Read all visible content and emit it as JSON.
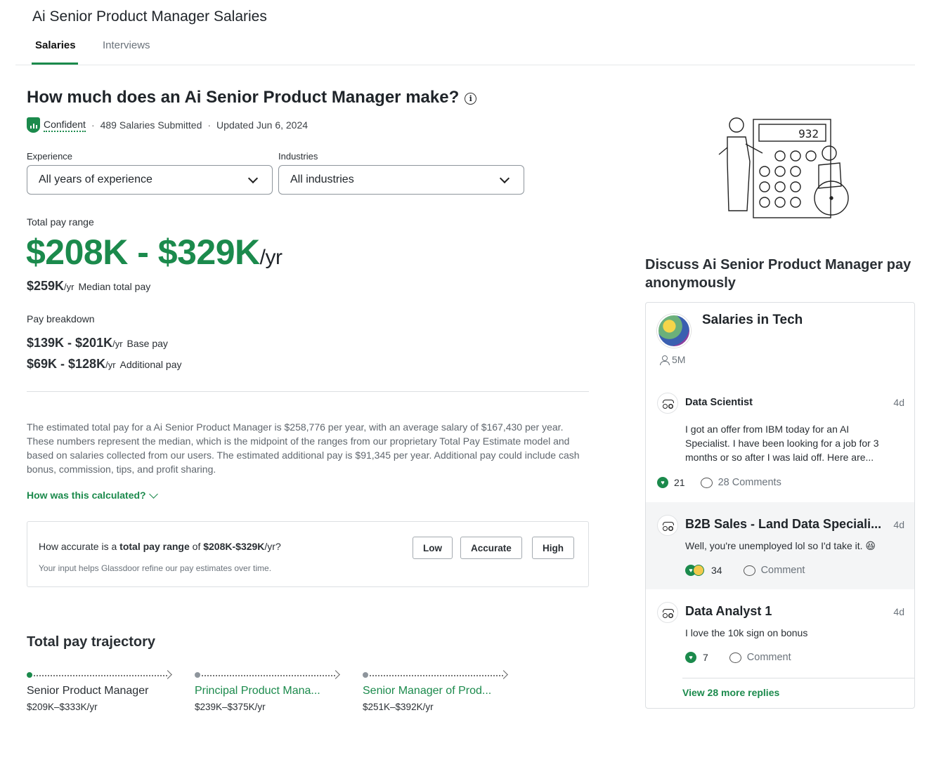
{
  "page_title": "Ai Senior Product Manager Salaries",
  "tabs": [
    {
      "label": "Salaries",
      "active": true
    },
    {
      "label": "Interviews",
      "active": false
    }
  ],
  "heading": "How much does an Ai Senior Product Manager make?",
  "meta": {
    "confidence": "Confident",
    "submitted": "489 Salaries Submitted",
    "updated": "Updated Jun 6, 2024"
  },
  "filters": {
    "experience_label": "Experience",
    "experience_value": "All years of experience",
    "industries_label": "Industries",
    "industries_value": "All industries"
  },
  "total_pay": {
    "label": "Total pay range",
    "range": "$208K - $329K",
    "unit": "/yr",
    "median_value": "$259K",
    "median_unit": "/yr",
    "median_label": "Median total pay"
  },
  "breakdown": {
    "label": "Pay breakdown",
    "base_value": "$139K - $201K",
    "base_unit": "/yr",
    "base_label": "Base pay",
    "additional_value": "$69K - $128K",
    "additional_unit": "/yr",
    "additional_label": "Additional pay"
  },
  "description": "The estimated total pay for a Ai Senior Product Manager is $258,776 per year, with an average salary of $167,430 per year. These numbers represent the median, which is the midpoint of the ranges from our proprietary Total Pay Estimate model and based on salaries collected from our users. The estimated additional pay is $91,345 per year. Additional pay could include cash bonus, commission, tips, and profit sharing.",
  "how_calculated": "How was this calculated?",
  "accuracy": {
    "q_prefix": "How accurate is a ",
    "q_bold": "total pay range",
    "q_mid": " of ",
    "q_range": "$208K-$329K",
    "q_suffix": "/yr?",
    "note": "Your input helps Glassdoor refine our pay estimates over time.",
    "buttons": [
      "Low",
      "Accurate",
      "High"
    ]
  },
  "trajectory": {
    "title": "Total pay trajectory",
    "items": [
      {
        "role": "Senior Product Manager",
        "pay": "$209K–$333K/yr",
        "current": true
      },
      {
        "role": "Principal Product Mana...",
        "pay": "$239K–$375K/yr",
        "current": false
      },
      {
        "role": "Senior Manager of Prod...",
        "pay": "$251K–$392K/yr",
        "current": false
      }
    ]
  },
  "illustration": {
    "display": "932"
  },
  "discussion": {
    "title": "Discuss Ai Senior Product Manager pay anonymously",
    "bowl_name": "Salaries in Tech",
    "bowl_members": "5M",
    "posts": [
      {
        "author": "Data Scientist",
        "time": "4d",
        "body": "I got an offer from IBM today for an AI Specialist. I have been looking for a job for 3 months or so after I was laid off. Here are...",
        "reactions": "21",
        "comments": "28 Comments"
      },
      {
        "author": "B2B Sales - Land Data Speciali...",
        "time": "4d",
        "body": "Well, you're unemployed lol so I'd take it. 😆",
        "reactions": "34",
        "comments": "Comment"
      },
      {
        "author": "Data Analyst 1",
        "time": "4d",
        "body": "I love the 10k sign on bonus",
        "reactions": "7",
        "comments": "Comment"
      }
    ],
    "view_more": "View 28 more replies"
  },
  "colors": {
    "brand_green": "#1b8a4c"
  }
}
